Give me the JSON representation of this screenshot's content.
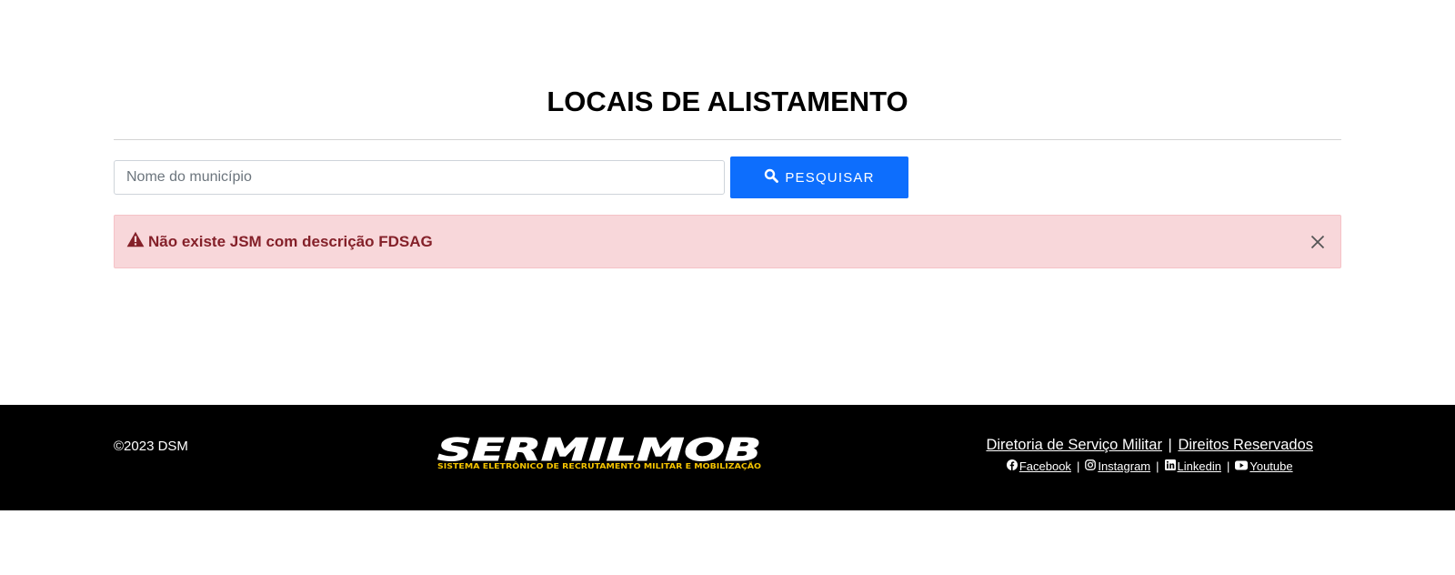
{
  "page": {
    "title": "LOCAIS DE ALISTAMENTO"
  },
  "search": {
    "placeholder": "Nome do município",
    "value": "",
    "button_label": "PESQUISAR",
    "button_icon": "search-icon"
  },
  "alert": {
    "icon": "warning-triangle-icon",
    "message": "Não existe JSM com descrição FDSAG",
    "close_icon": "close-icon"
  },
  "footer": {
    "copyright": "©2023 DSM",
    "logo": {
      "main_text": "SERMILMOB",
      "sub_text": "SISTEMA ELETRÔNICO DE RECRUTAMENTO MILITAR E MOBILIZAÇÃO"
    },
    "links": {
      "directorate": "Diretoria de Serviço Militar",
      "separator": "|",
      "rights": "Direitos Reservados"
    },
    "social": [
      {
        "label": " Facebook",
        "icon": "facebook-icon"
      },
      {
        "label": " Instagram",
        "icon": "instagram-icon"
      },
      {
        "label": " Linkedin",
        "icon": "linkedin-icon"
      },
      {
        "label": " Youtube",
        "icon": "youtube-icon"
      }
    ]
  },
  "colors": {
    "primary_button": "#0d6efd",
    "alert_bg": "#f8d7da",
    "alert_text": "#842029",
    "footer_bg": "#000000",
    "logo_sub": "#f5c400"
  }
}
